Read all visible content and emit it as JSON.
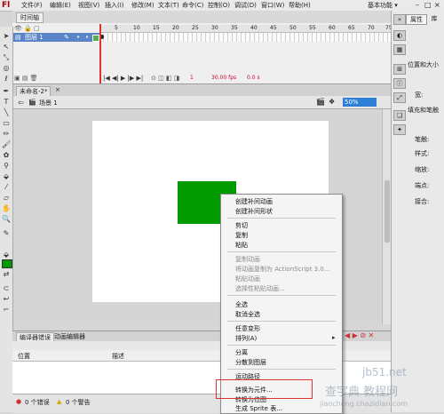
{
  "app": {
    "logo": "Fl",
    "workspace_label": "基本功能 ▾"
  },
  "menubar": {
    "items": [
      "文件(F)",
      "编辑(E)",
      "视图(V)",
      "插入(I)",
      "修改(M)",
      "文本(T)",
      "命令(C)",
      "控制(O)",
      "调试(D)",
      "窗口(W)",
      "帮助(H)"
    ]
  },
  "timeline": {
    "tab_label": "时间轴",
    "layer_name": "图层 1",
    "frame_numbers": [
      "5",
      "10",
      "15",
      "20",
      "25",
      "30",
      "35",
      "40",
      "45",
      "50",
      "55",
      "60",
      "65",
      "70",
      "75"
    ],
    "status": "1",
    "fps": "30.00 fps",
    "time": "0.0 s"
  },
  "document": {
    "tab_label": "未命名-2*",
    "scene_label": "场景 1",
    "zoom": "50%"
  },
  "context_menu": {
    "items": [
      {
        "label": "创建补间动画",
        "disabled": false
      },
      {
        "label": "创建补间形状",
        "disabled": false
      },
      {
        "label": "剪切",
        "disabled": false
      },
      {
        "label": "复制",
        "disabled": false
      },
      {
        "label": "粘贴",
        "disabled": false
      },
      {
        "label": "复制动画",
        "disabled": true
      },
      {
        "label": "将动画复制为 ActionScript 3.0...",
        "disabled": true
      },
      {
        "label": "粘贴动画",
        "disabled": true
      },
      {
        "label": "选择性粘贴动画...",
        "disabled": true
      },
      {
        "label": "全选",
        "disabled": false
      },
      {
        "label": "取消全选",
        "disabled": false
      },
      {
        "label": "任意变形",
        "disabled": false
      },
      {
        "label": "排列(A)",
        "disabled": false
      },
      {
        "label": "分离",
        "disabled": false
      },
      {
        "label": "分散到图层",
        "disabled": false
      },
      {
        "label": "运动路径",
        "disabled": false
      },
      {
        "label": "转换为元件...",
        "disabled": false
      },
      {
        "label": "转换为位图",
        "disabled": false
      },
      {
        "label": "生成 Sprite 表...",
        "disabled": false
      }
    ],
    "submenu_arrow": "▸"
  },
  "bottom_panel": {
    "tabs": [
      "编译器错误",
      "动画编辑器"
    ],
    "col_location": "位置",
    "col_description": "描述",
    "errors": "0 个错误",
    "warnings": "0 个警告"
  },
  "right_panel": {
    "tabs": [
      "属性",
      "库"
    ],
    "section_position": "位置和大小",
    "section_fill": "填充和笔触",
    "fields": [
      "宽:",
      "笔触:",
      "样式:",
      "缩放:",
      "端点:",
      "接合:"
    ]
  },
  "watermarks": {
    "site1": "jb51.net",
    "site2": "查字典 教程网",
    "site3": "jiaocheng.chazidian.com"
  },
  "colors": {
    "shape_fill": "#009a00",
    "layer_highlight": "#5a84c8",
    "playhead": "#e03030",
    "highlight_border": "#dd3333"
  }
}
